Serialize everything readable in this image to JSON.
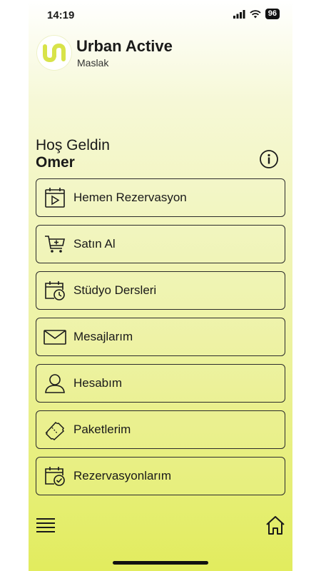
{
  "status_bar": {
    "time": "14:19",
    "battery": "96"
  },
  "header": {
    "title": "Urban Active",
    "subtitle": "Maslak"
  },
  "greeting": {
    "line1": "Hoş Geldin",
    "name": "Omer"
  },
  "menu": {
    "items": [
      {
        "label": "Hemen Rezervasyon",
        "icon": "play-calendar-icon"
      },
      {
        "label": "Satın Al",
        "icon": "cart-icon"
      },
      {
        "label": "Stüdyo Dersleri",
        "icon": "calendar-clock-icon"
      },
      {
        "label": "Mesajlarım",
        "icon": "envelope-icon"
      },
      {
        "label": "Hesabım",
        "icon": "user-icon"
      },
      {
        "label": "Paketlerim",
        "icon": "ticket-icon"
      },
      {
        "label": "Rezervasyonlarım",
        "icon": "calendar-check-icon"
      }
    ]
  },
  "colors": {
    "accent": "#e2ec5e",
    "border": "#2b2b2b"
  }
}
